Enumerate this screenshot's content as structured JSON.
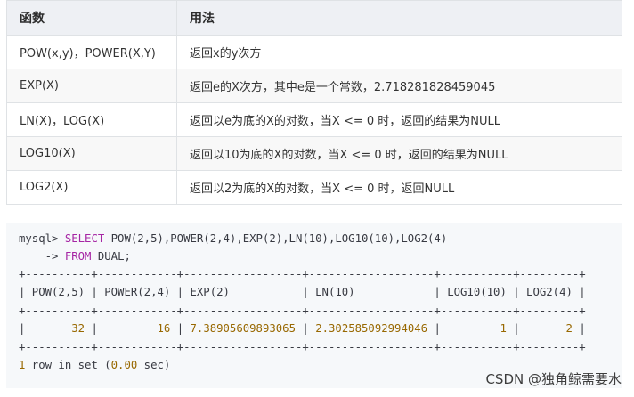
{
  "table": {
    "headers": [
      "函数",
      "用法"
    ],
    "rows": [
      [
        "POW(x,y)，POWER(X,Y)",
        "返回x的y次方"
      ],
      [
        "EXP(X)",
        "返回e的X次方，其中e是一个常数，2.718281828459045"
      ],
      [
        "LN(X)，LOG(X)",
        "返回以e为底的X的对数，当X <= 0 时，返回的结果为NULL"
      ],
      [
        "LOG10(X)",
        "返回以10为底的X的对数，当X <= 0 时，返回的结果为NULL"
      ],
      [
        "LOG2(X)",
        "返回以2为底的X的对数，当X <= 0 时，返回NULL"
      ]
    ]
  },
  "code": {
    "prompt": "mysql> ",
    "select_kw": "SELECT",
    "select_rest": " POW(2,5),POWER(2,4),EXP(2),LN(10),LOG10(10),LOG2(4)",
    "cont_prefix": "    -> ",
    "from_kw": "FROM",
    "from_rest": " DUAL;",
    "border": "+----------+------------+------------------+-------------------+-----------+---------+",
    "header_row": "| POW(2,5) | POWER(2,4) | EXP(2)           | LN(10)            | LOG10(10) | LOG2(4) |",
    "r1": "|       ",
    "v1": "32",
    "r2": " |         ",
    "v2": "16",
    "r3": " | ",
    "v3": "7.38905609893065",
    "r4": " | ",
    "v4": "2.302585092994046",
    "r5": " |         ",
    "v5": "1",
    "r6": " |       ",
    "v6": "2",
    "r7": " |",
    "result_n": "1",
    "result_text1": " row in set (",
    "result_time": "0.00",
    "result_text2": " sec)"
  },
  "watermark": "CSDN @独角鲸需要水"
}
